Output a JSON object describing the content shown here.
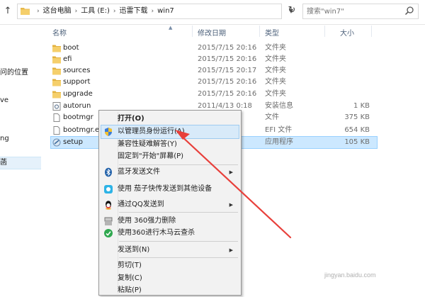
{
  "address_bar": {
    "breadcrumbs": [
      "这台电脑",
      "工具 (E:)",
      "迅雷下载",
      "win7"
    ],
    "search_placeholder": "搜索\"win7\""
  },
  "nav_pane": {
    "items": [
      "问的位置",
      "ve",
      "ng",
      "菡"
    ]
  },
  "columns": {
    "name": "名称",
    "date": "修改日期",
    "type": "类型",
    "size": "大小"
  },
  "files": [
    {
      "name": "boot",
      "date": "2015/7/15 20:16",
      "type": "文件夹",
      "size": "",
      "icon": "folder-icon"
    },
    {
      "name": "efi",
      "date": "2015/7/15 20:16",
      "type": "文件夹",
      "size": "",
      "icon": "folder-icon"
    },
    {
      "name": "sources",
      "date": "2015/7/15 20:17",
      "type": "文件夹",
      "size": "",
      "icon": "folder-icon"
    },
    {
      "name": "support",
      "date": "2015/7/15 20:16",
      "type": "文件夹",
      "size": "",
      "icon": "folder-icon"
    },
    {
      "name": "upgrade",
      "date": "2015/7/15 20:16",
      "type": "文件夹",
      "size": "",
      "icon": "folder-icon"
    },
    {
      "name": "autorun",
      "date": "2011/4/13 0:18",
      "type": "安装信息",
      "size": "1 KB",
      "icon": "settings-file-icon"
    },
    {
      "name": "bootmgr",
      "date": "18",
      "type": "文件",
      "size": "375 KB",
      "icon": "file-icon"
    },
    {
      "name": "bootmgr.e",
      "date": "18",
      "type": "EFI 文件",
      "size": "654 KB",
      "icon": "file-icon"
    },
    {
      "name": "setup",
      "date": "18",
      "type": "应用程序",
      "size": "105 KB",
      "icon": "setup-app-icon"
    }
  ],
  "context_menu": {
    "items": [
      {
        "label": "打开(O)",
        "bold": true
      },
      {
        "label": "以管理员身份运行(A)",
        "icon": "admin-shield-icon",
        "highlighted": true
      },
      {
        "label": "兼容性疑难解答(Y)"
      },
      {
        "label": "固定到\"开始\"屏幕(P)"
      },
      {
        "label": "蓝牙发送文件",
        "icon": "bluetooth-icon",
        "submenu": true
      },
      {
        "label": "使用 茄子快传发送到其他设备",
        "icon": "transfer-app-icon"
      },
      {
        "label": "通过QQ发送到",
        "icon": "qq-icon",
        "submenu": true
      },
      {
        "label": "使用 360强力删除",
        "icon": "shredder-icon"
      },
      {
        "label": "使用360进行木马云查杀",
        "icon": "antivirus-icon"
      },
      {
        "label": "发送到(N)",
        "submenu": true
      },
      {
        "label": "剪切(T)"
      },
      {
        "label": "复制(C)"
      },
      {
        "label": "粘贴(P)"
      }
    ]
  },
  "watermark": "jingyan.baidu.com",
  "colors": {
    "selection": "#cce8ff",
    "menu_highlight": "#d8eaf9",
    "arrow": "#e8403b",
    "folder": "#f2c45a"
  }
}
